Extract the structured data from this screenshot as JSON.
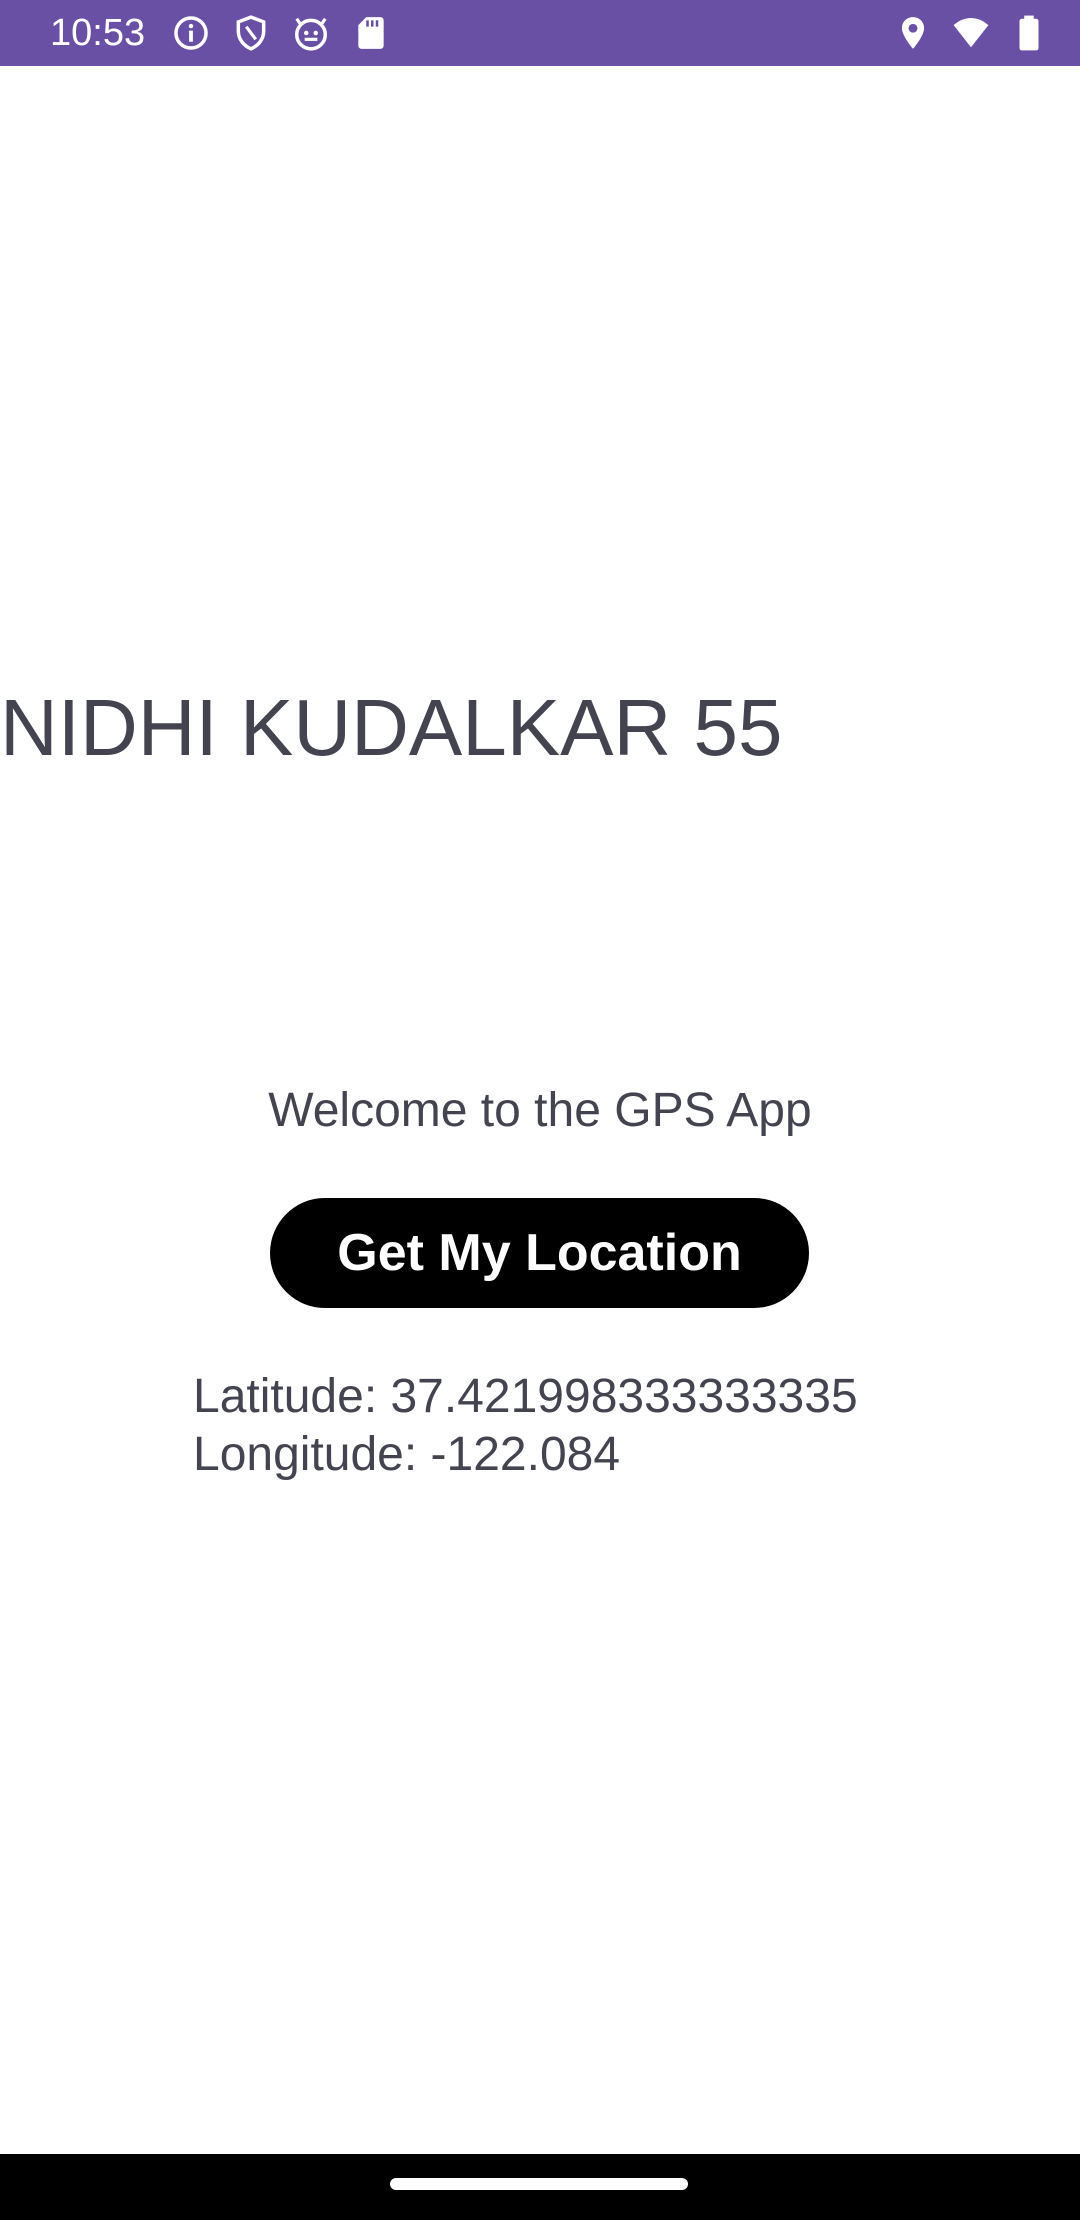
{
  "status_bar": {
    "time": "10:53",
    "background_color": "#6a50a5",
    "left_icons": [
      "info-icon",
      "shield-icon",
      "android-icon",
      "sd-card-icon"
    ],
    "right_icons": [
      "location-icon",
      "wifi-icon",
      "battery-icon"
    ]
  },
  "main": {
    "title": "NIDHI KUDALKAR 55",
    "welcome": "Welcome to the GPS App",
    "button_label": "Get My Location",
    "latitude": "Latitude: 37.421998333333335",
    "longitude": "Longitude: -122.084"
  },
  "colors": {
    "text": "#444450",
    "button_bg": "#000000",
    "button_text": "#ffffff"
  }
}
